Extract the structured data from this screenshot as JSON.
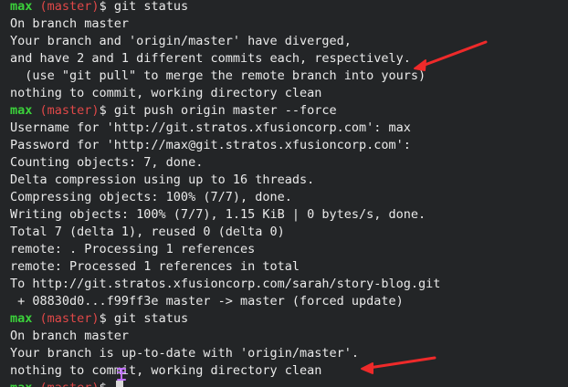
{
  "prompt": {
    "user": "max",
    "branch": "(master)",
    "symbol": "$"
  },
  "lines": [
    {
      "type": "prompt",
      "command": " git status"
    },
    {
      "type": "output",
      "text": "On branch master"
    },
    {
      "type": "output",
      "text": "Your branch and 'origin/master' have diverged,"
    },
    {
      "type": "output",
      "text": "and have 2 and 1 different commits each, respectively."
    },
    {
      "type": "output",
      "text": "  (use \"git pull\" to merge the remote branch into yours)"
    },
    {
      "type": "output",
      "text": "nothing to commit, working directory clean"
    },
    {
      "type": "prompt",
      "command": " git push origin master --force"
    },
    {
      "type": "output",
      "text": "Username for 'http://git.stratos.xfusioncorp.com': max"
    },
    {
      "type": "output",
      "text": "Password for 'http://max@git.stratos.xfusioncorp.com':"
    },
    {
      "type": "output",
      "text": "Counting objects: 7, done."
    },
    {
      "type": "output",
      "text": "Delta compression using up to 16 threads."
    },
    {
      "type": "output",
      "text": "Compressing objects: 100% (7/7), done."
    },
    {
      "type": "output",
      "text": "Writing objects: 100% (7/7), 1.15 KiB | 0 bytes/s, done."
    },
    {
      "type": "output",
      "text": "Total 7 (delta 1), reused 0 (delta 0)"
    },
    {
      "type": "output",
      "text": "remote: . Processing 1 references"
    },
    {
      "type": "output",
      "text": "remote: Processed 1 references in total"
    },
    {
      "type": "output",
      "text": "To http://git.stratos.xfusioncorp.com/sarah/story-blog.git"
    },
    {
      "type": "output",
      "text": " + 08830d0...f99ff3e master -> master (forced update)"
    },
    {
      "type": "prompt",
      "command": " git status"
    },
    {
      "type": "output",
      "text": "On branch master"
    },
    {
      "type": "output",
      "text": "Your branch is up-to-date with 'origin/master'."
    },
    {
      "type": "output",
      "text": "nothing to commit, working directory clean"
    },
    {
      "type": "prompt",
      "command": " ",
      "cursor": true
    }
  ],
  "colors": {
    "background": "#232527",
    "text": "#eaeaea",
    "user": "#3bd13b",
    "branch": "#e04848",
    "annotation_arrow": "#ee2a2a",
    "ibeam": "#c070ff"
  }
}
